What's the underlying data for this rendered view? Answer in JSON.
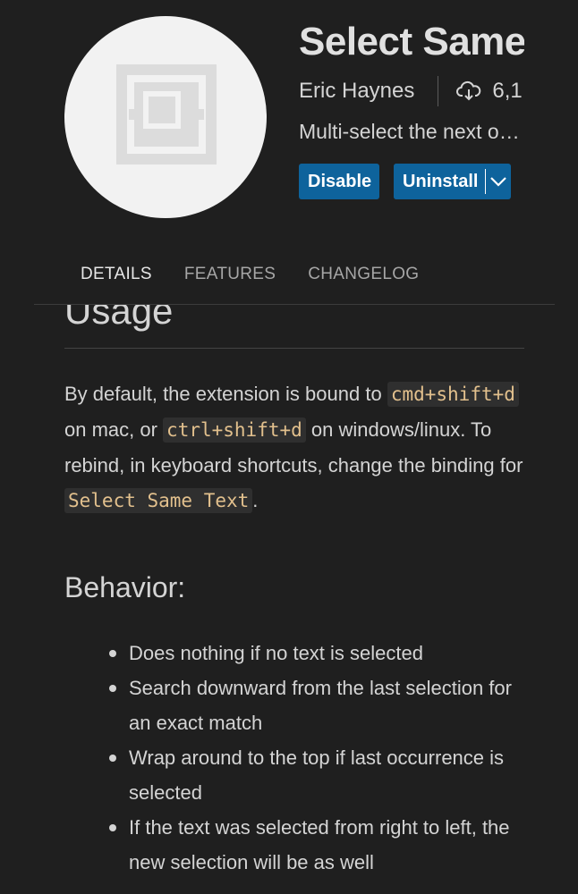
{
  "extension": {
    "title": "Select Same Text",
    "publisher": "Eric Haynes",
    "installs": "6,1",
    "description": "Multi-select the next occurrence of the selected text",
    "logo_icon": "select-same-logo-icon"
  },
  "buttons": {
    "disable_label": "Disable",
    "uninstall_label": "Uninstall"
  },
  "tabs": [
    {
      "label": "DETAILS",
      "active": true
    },
    {
      "label": "FEATURES",
      "active": false
    },
    {
      "label": "CHANGELOG",
      "active": false
    }
  ],
  "content": {
    "usage_heading": "Usage",
    "para": {
      "t1": "By default, the extension is bound to ",
      "c1": "cmd+shift+d",
      "t2": " on mac, or ",
      "c2": "ctrl+shift+d",
      "t3": " on windows/linux. To rebind, in keyboard shortcuts, change the binding for ",
      "c3": "Select Same Text",
      "t4": "."
    },
    "behavior_heading": "Behavior:",
    "bullets": [
      "Does nothing if no text is selected",
      "Search downward from the last selection for an exact match",
      "Wrap around to the top if last occurrence is selected",
      "If the text was selected from right to left, the new selection will be as well"
    ]
  },
  "colors": {
    "background": "#1f1f1f",
    "button": "#0e639c",
    "code": "#e2c08d"
  }
}
